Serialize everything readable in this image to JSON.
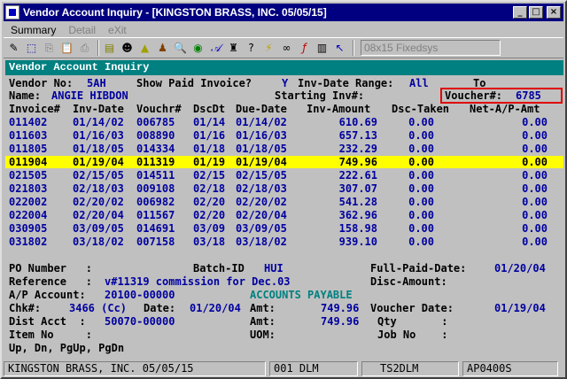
{
  "window": {
    "title": "Vendor Account Inquiry - [KINGSTON BRASS, INC. 05/05/15]"
  },
  "menu": [
    "Summary",
    "Detail",
    "eXit"
  ],
  "toolbar": {
    "font_selector": "08x15 Fixedsys"
  },
  "screen": {
    "header": "Vendor Account Inquiry",
    "vendor_no_label": "Vendor No:",
    "vendor_no": "5AH",
    "show_paid_label": "Show Paid Invoice?",
    "show_paid": "Y",
    "inv_date_range_label": "Inv-Date Range:",
    "inv_date_range": "All",
    "to_label": "To",
    "name_label": "Name:",
    "name": "ANGIE HIBDON",
    "starting_inv_label": "Starting Inv#:",
    "voucher_label": "Voucher#:",
    "voucher": "6785",
    "columns": [
      "Invoice#",
      "Inv-Date",
      "Vouchr#",
      "DscDt",
      "Due-Date",
      "Inv-Amount",
      "Dsc-Taken",
      "Net-A/P-Amt"
    ],
    "rows": [
      [
        "011402",
        "01/14/02",
        "006785",
        "01/14",
        "01/14/02",
        "610.69",
        "0.00",
        "0.00"
      ],
      [
        "011603",
        "01/16/03",
        "008890",
        "01/16",
        "01/16/03",
        "657.13",
        "0.00",
        "0.00"
      ],
      [
        "011805",
        "01/18/05",
        "014334",
        "01/18",
        "01/18/05",
        "232.29",
        "0.00",
        "0.00"
      ],
      [
        "011904",
        "01/19/04",
        "011319",
        "01/19",
        "01/19/04",
        "749.96",
        "0.00",
        "0.00"
      ],
      [
        "021505",
        "02/15/05",
        "014511",
        "02/15",
        "02/15/05",
        "222.61",
        "0.00",
        "0.00"
      ],
      [
        "021803",
        "02/18/03",
        "009108",
        "02/18",
        "02/18/03",
        "307.07",
        "0.00",
        "0.00"
      ],
      [
        "022002",
        "02/20/02",
        "006982",
        "02/20",
        "02/20/02",
        "541.28",
        "0.00",
        "0.00"
      ],
      [
        "022004",
        "02/20/04",
        "011567",
        "02/20",
        "02/20/04",
        "362.96",
        "0.00",
        "0.00"
      ],
      [
        "030905",
        "03/09/05",
        "014691",
        "03/09",
        "03/09/05",
        "158.98",
        "0.00",
        "0.00"
      ],
      [
        "031802",
        "03/18/02",
        "007158",
        "03/18",
        "03/18/02",
        "939.10",
        "0.00",
        "0.00"
      ]
    ],
    "selected_row_index": 3,
    "detail": {
      "po_number_label": "PO Number   :",
      "batch_id_label": "Batch-ID",
      "batch_id": "HUI",
      "full_paid_date_label": "Full-Paid-Date:",
      "full_paid_date": "01/20/04",
      "reference_label": "Reference   :",
      "reference": "v#11319 commission for Dec.03",
      "disc_amount_label": "Disc-Amount:",
      "ap_account_label": "A/P Account:",
      "ap_account": "20100-00000",
      "ap_account_name": "ACCOUNTS PAYABLE",
      "chk_label": "Chk#:",
      "chk": "3466 (Cc)",
      "date_label": "Date:",
      "date": "01/20/04",
      "amt_label": "Amt:",
      "amt": "749.96",
      "voucher_date_label": "Voucher Date:",
      "voucher_date": "01/19/04",
      "dist_acct_label": "Dist Acct  :",
      "dist_acct": "50070-00000",
      "amt2_label": "Amt:",
      "amt2": "749.96",
      "qty_label": "Qty       :",
      "item_no_label": "Item No     :",
      "uom_label": "UOM:",
      "job_no_label": "Job No    :",
      "keys_hint": "Up, Dn, PgUp, PgDn"
    }
  },
  "status": {
    "company": "KINGSTON BRASS, INC. 05/05/15",
    "user": "001 DLM",
    "terminal": "TS2DLM",
    "program": "AP0400S"
  },
  "colors": {
    "title_bg": "#000080",
    "header_bg": "#008080",
    "label": "#000000",
    "value": "#0000a0",
    "highlight": "#ffff00",
    "voucher_box": "#e00000"
  }
}
